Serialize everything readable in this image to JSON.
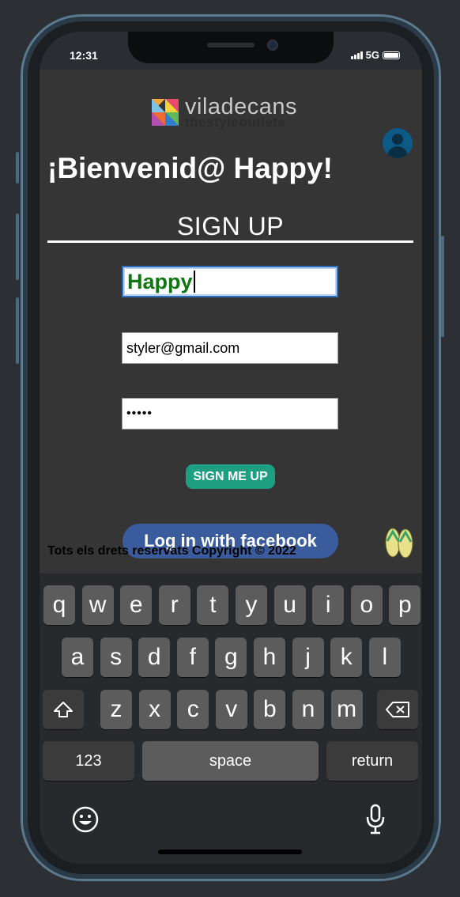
{
  "status_bar": {
    "time": "12:31",
    "network": "5G"
  },
  "app": {
    "brand": {
      "name_top": "viladecans",
      "name_bottom": "thestyleoutlets"
    },
    "welcome": "¡Bienvenid@ Happy!",
    "form_title": "SIGN UP",
    "name_field": {
      "value": "Happy"
    },
    "email_field": {
      "value": "styler@gmail.com"
    },
    "password_field": {
      "value": "•••••"
    },
    "signup_button": "SIGN ME UP",
    "facebook_button": "Log in with facebook",
    "copyright": "Tots els drets reservats Copyright © 2022"
  },
  "keyboard": {
    "row1": [
      "q",
      "w",
      "e",
      "r",
      "t",
      "y",
      "u",
      "i",
      "o",
      "p"
    ],
    "row2": [
      "a",
      "s",
      "d",
      "f",
      "g",
      "h",
      "j",
      "k",
      "l"
    ],
    "row3": [
      "z",
      "x",
      "c",
      "v",
      "b",
      "n",
      "m"
    ],
    "numbers_key": "123",
    "space_key": "space",
    "return_key": "return"
  },
  "colors": {
    "app_background": "#353535",
    "signup_button": "#1e9f82",
    "facebook_button": "#3a5b9c",
    "name_text": "#127712"
  }
}
